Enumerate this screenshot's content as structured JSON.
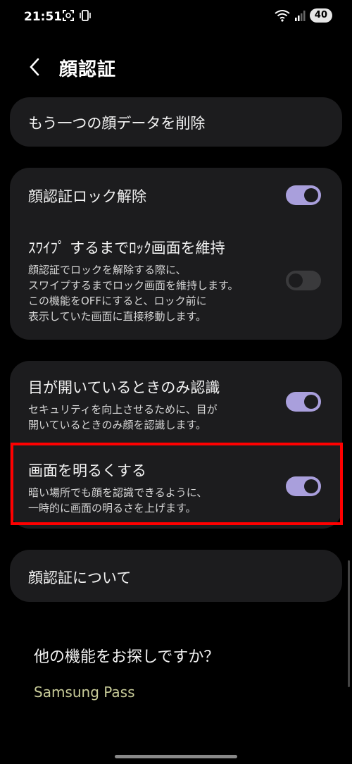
{
  "status": {
    "time": "21:51",
    "battery": "40",
    "icons": [
      "face-scan-icon",
      "vibrate-icon",
      "wifi-icon",
      "signal-icon",
      "battery-icon"
    ]
  },
  "header": {
    "title": "顔認証"
  },
  "cards": {
    "delete": {
      "label": "もう一つの顔データを削除"
    },
    "lock": {
      "face_unlock": {
        "label": "顔認証ロック解除",
        "state": "on"
      },
      "keep_lock": {
        "label": "ｽﾜｲﾌﾟ するまでﾛｯｸ画面を維持",
        "desc1": "顔認証でロックを解除する際に、",
        "desc2": "スワイプするまでロック画面を維持します。",
        "desc3": "この機能をOFFにすると、ロック前に",
        "desc4": "表示していた画面に直接移動します。",
        "state": "off"
      }
    },
    "recognition": {
      "eyes_open": {
        "label": "目が開いているときのみ認識",
        "desc1": "セキュリティを向上させるために、目が",
        "desc2": "開いているときのみ顔を認識します。",
        "state": "on"
      },
      "brighten": {
        "label": "画面を明るくする",
        "desc1": "暗い場所でも顔を認識できるように、",
        "desc2": "一時的に画面の明るさを上げます。",
        "state": "on"
      }
    },
    "about": {
      "label": "顔認証について"
    }
  },
  "more": {
    "title": "他の機能をお探しですか？",
    "link": "Samsung Pass"
  },
  "colors": {
    "toggle_on": "#a99fdc",
    "card_bg": "#1c1c1e",
    "highlight": "#ff0000",
    "link": "#c9cc99"
  }
}
